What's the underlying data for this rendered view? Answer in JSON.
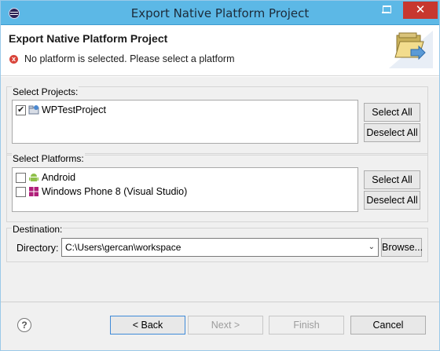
{
  "window": {
    "title": "Export Native Platform Project",
    "minimize_icon": "minimize-icon",
    "maximize_icon": "maximize-icon",
    "close_symbol": "✕"
  },
  "header": {
    "title": "Export Native Platform Project",
    "error_message": "No platform is selected. Please select a platform",
    "error_symbol": "x"
  },
  "projects": {
    "label": "Select Projects:",
    "items": [
      {
        "label": "WPTestProject",
        "checked": true,
        "icon": "project-folder-icon"
      }
    ],
    "select_all": "Select All",
    "deselect_all": "Deselect All"
  },
  "platforms": {
    "label": "Select Platforms:",
    "items": [
      {
        "label": "Android",
        "checked": false,
        "icon": "android-icon"
      },
      {
        "label": "Windows Phone 8 (Visual Studio)",
        "checked": false,
        "icon": "windows-icon"
      }
    ],
    "select_all": "Select All",
    "deselect_all": "Deselect All"
  },
  "destination": {
    "label": "Destination:",
    "directory_label": "Directory:",
    "directory_value": "C:\\Users\\gercan\\workspace",
    "browse": "Browse..."
  },
  "footer": {
    "help_symbol": "?",
    "back": "< Back",
    "next": "Next >",
    "finish": "Finish",
    "cancel": "Cancel"
  }
}
